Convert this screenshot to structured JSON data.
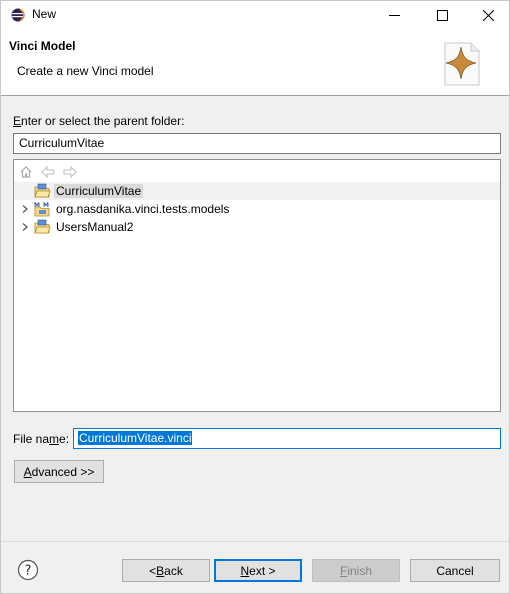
{
  "window": {
    "title": "New"
  },
  "banner": {
    "title": "Vinci Model",
    "description": "Create a new Vinci model"
  },
  "parent_folder": {
    "label": "Enter or select the parent folder:",
    "value": "CurriculumVitae"
  },
  "tree": {
    "items": [
      {
        "label": "CurriculumVitae",
        "expandable": false,
        "selected": true,
        "icon": "open-project-icon"
      },
      {
        "label": "org.nasdanika.vinci.tests.models",
        "expandable": true,
        "selected": false,
        "icon": "model-project-icon"
      },
      {
        "label": "UsersManual2",
        "expandable": true,
        "selected": false,
        "icon": "open-project-icon"
      }
    ]
  },
  "file_name": {
    "label": "File name:",
    "value": "CurriculumVitae.vinci"
  },
  "buttons": {
    "advanced": "Advanced >>",
    "back": "< Back",
    "next": "Next >",
    "finish": "Finish",
    "cancel": "Cancel"
  },
  "colors": {
    "accent": "#0078d7",
    "banner_star": "#c8893a"
  }
}
